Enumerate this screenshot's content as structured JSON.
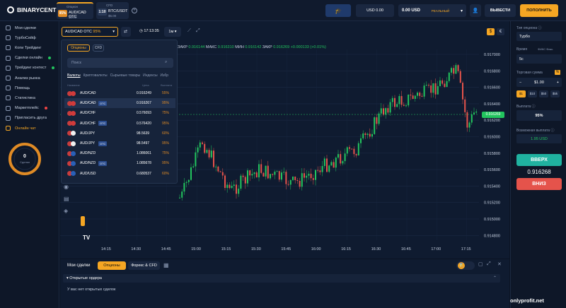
{
  "header": {
    "brand": "BINARYCENT",
    "asset_tabs": [
      {
        "category": "Опцион",
        "percent": "95%",
        "name": "AUD/CAD OTC",
        "amount": "$5.00"
      },
      {
        "category": "CFD",
        "percent": "1:10",
        "name": "BTC/USDT",
        "amount": "$5.00"
      }
    ],
    "demo_balance": "USD 0.00",
    "real_balance": "0.00 USD",
    "real_label": "РЕАЛЬНЫЙ",
    "withdraw_label": "ВЫВЕСТИ",
    "deposit_label": "ПОПОЛНИТЬ",
    "accent": "#f5a623"
  },
  "sidebar": {
    "items": [
      {
        "label": "Мои сделки",
        "icon": "trades-icon"
      },
      {
        "label": "ТурбоСейф",
        "icon": "shield-icon"
      },
      {
        "label": "Копи Трейдинг",
        "icon": "copy-icon"
      },
      {
        "label": "Сделки онлайн",
        "icon": "online-icon",
        "dot": "#22c55e"
      },
      {
        "label": "Трейдинг контест",
        "icon": "trophy-icon",
        "dot": "#22c55e"
      },
      {
        "label": "Анализ рынка",
        "icon": "analysis-icon"
      },
      {
        "label": "Помощь",
        "icon": "help-icon"
      },
      {
        "label": "Статистика",
        "icon": "stats-icon"
      },
      {
        "label": "Маркетплейс",
        "icon": "market-icon",
        "dot": "#ef4444"
      },
      {
        "label": "Пригласить друга",
        "icon": "invite-icon"
      },
      {
        "label": "Онлайн чат",
        "icon": "chat-icon"
      }
    ],
    "gauge_value": "0",
    "gauge_label": "Сделки"
  },
  "toolbar": {
    "asset": "AUD/CAD OTC",
    "asset_pct": "95%",
    "time": "17:13:35",
    "timeframe": "1м",
    "balance_badge": "$"
  },
  "stats_line": {
    "close_label": "ЗАКР",
    "close_val": "0.916144",
    "max_label": "МАКС",
    "max_val": "0.916310",
    "min_label": "МИН",
    "min_val": "0.916142",
    "close2_label": "ЗАКР",
    "close2_val": "0.916269",
    "change": "+0.000133 (+0.01%)"
  },
  "dropdown": {
    "tabs": [
      "Опционы",
      "CFD"
    ],
    "search_placeholder": "Поиск",
    "categories": [
      "Валюты",
      "Криптовалюты",
      "Сырьевые товары",
      "Индексы",
      "Избр"
    ],
    "col_asset": "Название",
    "col_price": "Цена",
    "col_payout": "Выплата",
    "rows": [
      {
        "name": "AUD/CAD",
        "otc": "",
        "price": "0.916249",
        "payout": "55%",
        "color": "#e08b25"
      },
      {
        "name": "AUD/CAD",
        "otc": "OTC",
        "price": "0.916267",
        "payout": "95%",
        "color": "#e08b25"
      },
      {
        "name": "AUD/CHF",
        "otc": "",
        "price": "0.576093",
        "payout": "75%",
        "color": "#e08b25"
      },
      {
        "name": "AUD/CHF",
        "otc": "OTC",
        "price": "0.576420",
        "payout": "95%",
        "color": "#e08b25"
      },
      {
        "name": "AUD/JPY",
        "otc": "",
        "price": "98.5639",
        "payout": "60%",
        "color": "#e08b25"
      },
      {
        "name": "AUD/JPY",
        "otc": "OTC",
        "price": "98.5497",
        "payout": "95%",
        "color": "#e08b25"
      },
      {
        "name": "AUD/NZD",
        "otc": "",
        "price": "1.086061",
        "payout": "75%",
        "color": "#e08b25"
      },
      {
        "name": "AUD/NZD",
        "otc": "OTC",
        "price": "1.085678",
        "payout": "95%",
        "color": "#e08b25"
      },
      {
        "name": "AUD/USD",
        "otc": "",
        "price": "0.680537",
        "payout": "60%",
        "color": "#e08b25"
      }
    ]
  },
  "chart_data": {
    "type": "candlestick",
    "yticks": [
      "0.917000",
      "0.916800",
      "0.916600",
      "0.916400",
      "0.916200",
      "0.916000",
      "0.915800",
      "0.915600",
      "0.915400",
      "0.915200",
      "0.915000",
      "0.914800"
    ],
    "xticks": [
      "14:15",
      "14:30",
      "14:45",
      "15:00",
      "15:15",
      "15:30",
      "15:45",
      "16:00",
      "16:15",
      "16:30",
      "16:45",
      "17:00",
      "17:15"
    ],
    "current_price": "0.916269",
    "ylim": [
      0.9148,
      0.917
    ]
  },
  "right_panel": {
    "option_type_label": "Тип опциона",
    "option_type": "Турбо",
    "time_label": "Время",
    "time_tabs": [
      "ФИКС",
      "Фикс."
    ],
    "time_value": "5с",
    "amount_label": "Торговая сумма",
    "amount_value": "$1.00",
    "quick_amounts": [
      "$1",
      "$10",
      "$50",
      "$5k"
    ],
    "payout_label": "Выплата",
    "payout_value": "95%",
    "possible_payout_label": "Возможная выплата",
    "possible_payout_value": "1.95 USD",
    "up_label": "ВВЕРХ",
    "price": "0.916268",
    "down_label": "ВНИЗ"
  },
  "bottom": {
    "title": "Мои сделки",
    "tabs": [
      "Опционы",
      "Форекс & CFD"
    ],
    "open_orders": "Открытые ордера",
    "no_trades": "У вас нет открытых сделок",
    "watermark": "onlyprofit.net"
  }
}
